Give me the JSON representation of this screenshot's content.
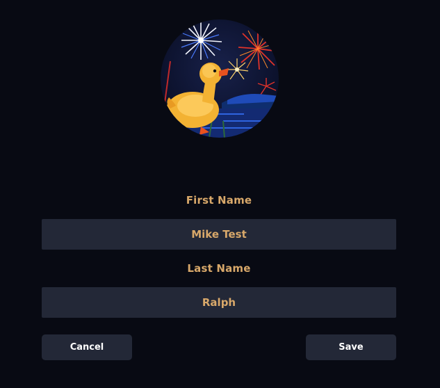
{
  "avatar": {
    "icon": "duck-fireworks-avatar",
    "colors": {
      "sky": "#0b1230",
      "duck": "#f3b233",
      "beak": "#e8521f",
      "water": "#1f4bb8",
      "firework_red": "#e0332a",
      "firework_white": "#f4f6ff",
      "firework_blue": "#4a7bff",
      "firework_gold": "#ffd36b"
    }
  },
  "form": {
    "first_name": {
      "label": "First Name",
      "value": "Mike Test"
    },
    "last_name": {
      "label": "Last Name",
      "value": "Ralph"
    }
  },
  "actions": {
    "cancel_label": "Cancel",
    "save_label": "Save"
  },
  "theme": {
    "background": "#080a13",
    "field_background": "#232837",
    "accent": "#d8a86a",
    "button_text": "#ffffff"
  }
}
